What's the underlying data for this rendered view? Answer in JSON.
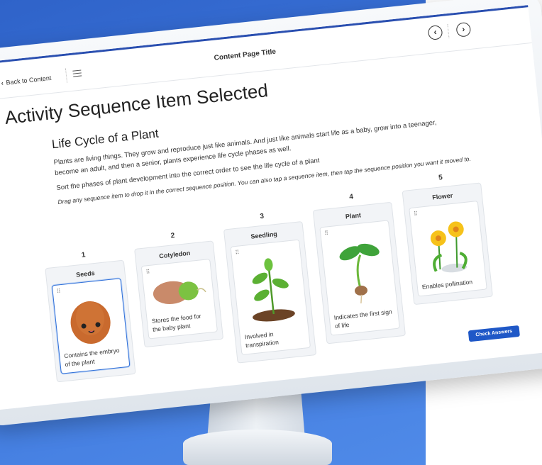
{
  "header": {
    "back_label": "Back to Content",
    "content_title": "Content Page Title",
    "prev_icon": "chevron-left-icon",
    "next_icon": "chevron-right-icon"
  },
  "main": {
    "heading": "Activity Sequence Item Selected",
    "subheading": "Life Cycle of a Plant",
    "paragraph": "Plants are living things. They grow and reproduce just like animals. And just like animals start life as a baby, grow into a teenager, become an adult, and then a senior, plants experience life cycle phases as well.",
    "instruction": "Sort the phases of plant development into the correct order to see the life cycle of a plant",
    "help": "Drag any sequence item to drop it in the correct sequence position. You can also tap a sequence item, then tap the sequence position you want it moved to."
  },
  "sequence": [
    {
      "position": "1",
      "title": "Seeds",
      "description": "Contains the embryo of the plant",
      "selected": true
    },
    {
      "position": "2",
      "title": "Cotyledon",
      "description": "Stores the food for the baby plant",
      "selected": false
    },
    {
      "position": "3",
      "title": "Seedling",
      "description": "Involved in transpiration",
      "selected": false
    },
    {
      "position": "4",
      "title": "Plant",
      "description": "Indicates the first sign of life",
      "selected": false
    },
    {
      "position": "5",
      "title": "Flower",
      "description": "Enables pollination",
      "selected": false
    }
  ],
  "actions": {
    "check_label": "Check Answers"
  },
  "colors": {
    "accent": "#1f58c7",
    "background": "#3d76dc"
  }
}
